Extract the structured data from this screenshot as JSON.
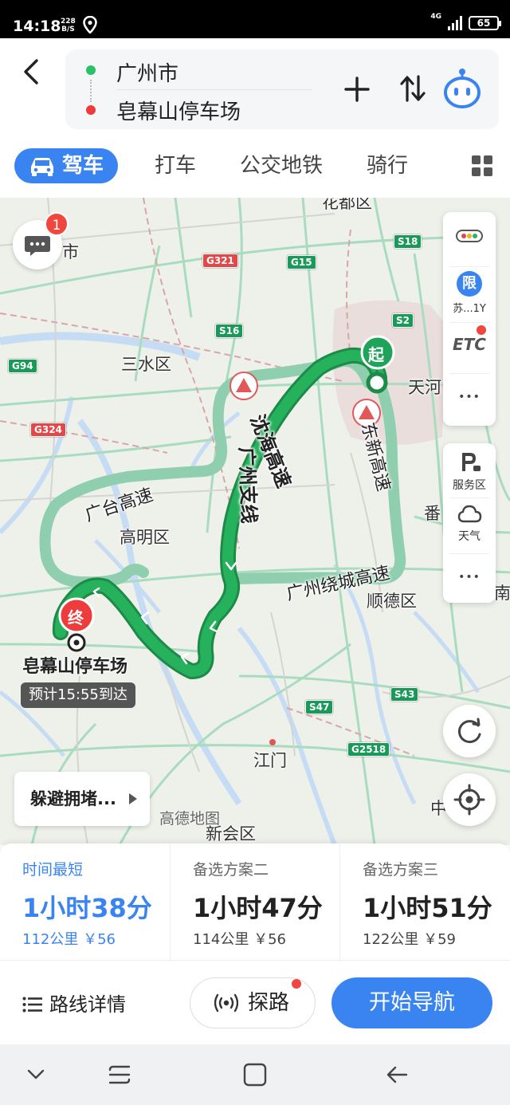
{
  "status_bar": {
    "time": "14:18",
    "net_speed_value": "228",
    "net_speed_unit": "B/S",
    "network": "4G",
    "battery": "65"
  },
  "route": {
    "start": "广州市",
    "end": "皂幕山停车场"
  },
  "modes": {
    "drive": "驾车",
    "taxi": "打车",
    "transit": "公交地铁",
    "bike": "骑行"
  },
  "map": {
    "places": [
      "三水区",
      "高明区",
      "顺德区",
      "天河",
      "江门",
      "新会区",
      "番",
      "中",
      "花都区",
      "市",
      "南"
    ],
    "roads": {
      "shenhai": "沈海高速",
      "shenhai_branch": "广州支线",
      "dongxin": "东新高速",
      "guangtai": "广台高速",
      "raocheng": "广州绕城高速"
    },
    "shields": [
      "G321",
      "G15",
      "S18",
      "S2",
      "S16",
      "G94",
      "G324",
      "S47",
      "S43",
      "G2518"
    ],
    "start_marker": "起",
    "end_marker": "终",
    "message_badge": "1",
    "dest_label": "皂幕山停车场",
    "eta": "预计15:55到达",
    "avoid_label": "躲避拥堵...",
    "watermark": "高德地图",
    "side": {
      "restrict_badge": "限",
      "restrict_plate": "苏...1Y",
      "etc": "ETC",
      "service": "服务区",
      "weather": "天气",
      "more": "•••"
    }
  },
  "plans": [
    {
      "label": "时间最短",
      "time": "1小时38分",
      "meta": "112公里 ￥56"
    },
    {
      "label": "备选方案二",
      "time": "1小时47分",
      "meta": "114公里 ￥56"
    },
    {
      "label": "备选方案三",
      "time": "1小时51分",
      "meta": "122公里 ￥59"
    }
  ],
  "actions": {
    "details": "路线详情",
    "explore": "探路",
    "navigate": "开始导航"
  },
  "colors": {
    "accent": "#3a84f2",
    "route": "#26b25c",
    "alt_route": "#8fcfb0",
    "danger": "#e24848"
  }
}
